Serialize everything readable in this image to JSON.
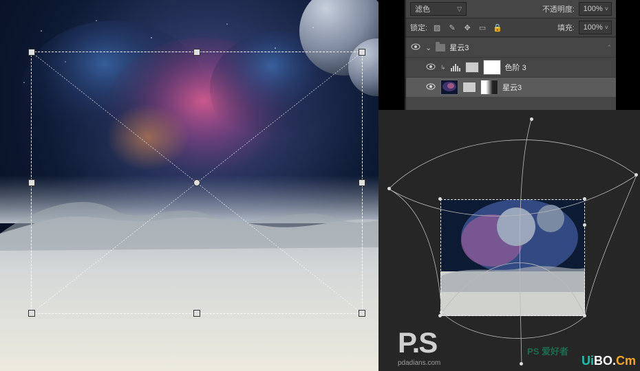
{
  "panel": {
    "blendMode": "滤色",
    "opacityLabel": "不透明度:",
    "opacityValue": "100%",
    "lockLabel": "锁定:",
    "fillLabel": "填充:",
    "fillValue": "100%"
  },
  "layers": {
    "group": {
      "name": "星云3"
    },
    "adjust": {
      "name": "色阶 3"
    },
    "nebula": {
      "name": "星云3"
    }
  },
  "icons": {
    "eye": "eye-icon",
    "chevron": "chevron-down-icon",
    "lockPixel": "lock-pixel-icon",
    "lockBrush": "lock-brush-icon",
    "lockMove": "lock-move-icon",
    "lockArtboard": "lock-artboard-icon",
    "lockAll": "lock-all-icon",
    "link": "link-icon",
    "levels": "levels-icon",
    "folder": "folder-icon"
  },
  "branding": {
    "logo": "P.S",
    "logoSub": "pdadians.com",
    "wm2": "PS 爱好者",
    "wm": "UiBO.Cm"
  },
  "canvas": {
    "transform": "free-transform-frame",
    "mini": "warp-thumbnail"
  }
}
